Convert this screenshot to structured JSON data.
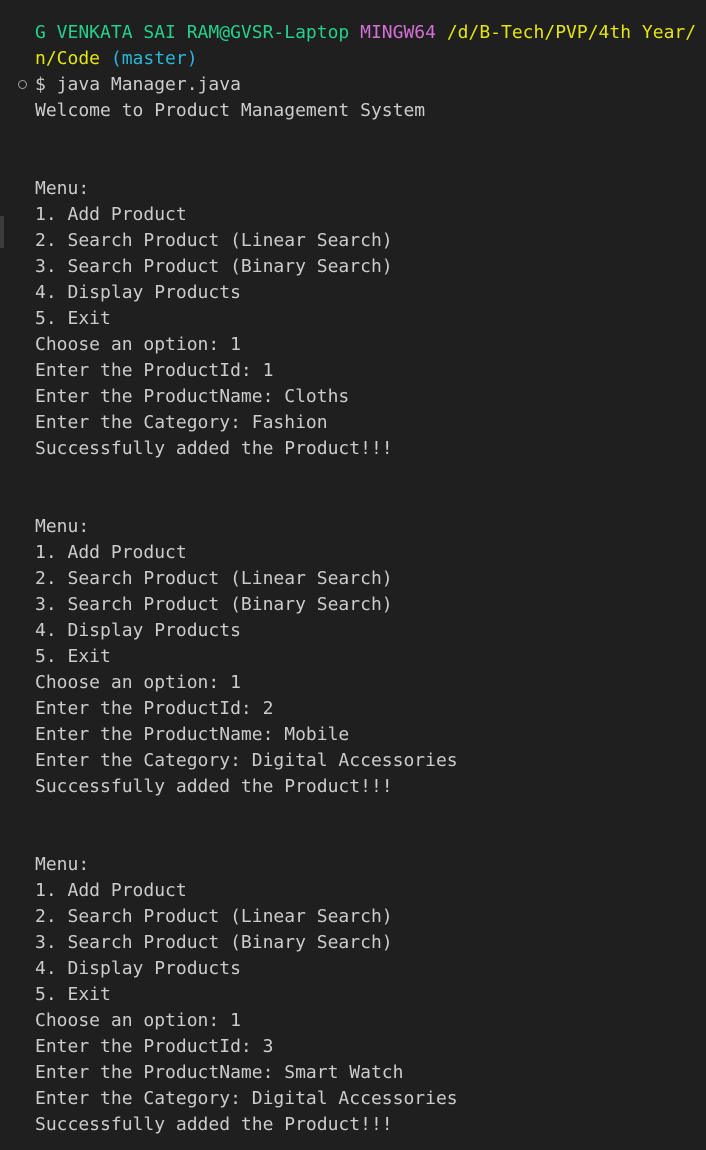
{
  "prompt": {
    "user_host": "G VENKATA SAI RAM@GVSR-Laptop",
    "msystem": "MINGW64",
    "path_line1": "/d/B-Tech/PVP/4th Year/",
    "path_line2": "n/Code",
    "branch": "(master)",
    "symbol": "$",
    "command": "java Manager.java"
  },
  "welcome": "Welcome to Product Management System",
  "menu": {
    "title": "Menu:",
    "options": [
      "1. Add Product",
      "2. Search Product (Linear Search)",
      "3. Search Product (Binary Search)",
      "4. Display Products",
      "5. Exit"
    ]
  },
  "sessions": [
    {
      "choose": "Choose an option: 1",
      "id": "Enter the ProductId: 1",
      "name": "Enter the ProductName: Cloths",
      "category": "Enter the Category: Fashion",
      "result": "Successfully added the Product!!!"
    },
    {
      "choose": "Choose an option: 1",
      "id": "Enter the ProductId: 2",
      "name": "Enter the ProductName: Mobile",
      "category": "Enter the Category: Digital Accessories",
      "result": "Successfully added the Product!!!"
    },
    {
      "choose": "Choose an option: 1",
      "id": "Enter the ProductId: 3",
      "name": "Enter the ProductName: Smart Watch",
      "category": "Enter the Category: Digital Accessories",
      "result": "Successfully added the Product!!!"
    }
  ]
}
